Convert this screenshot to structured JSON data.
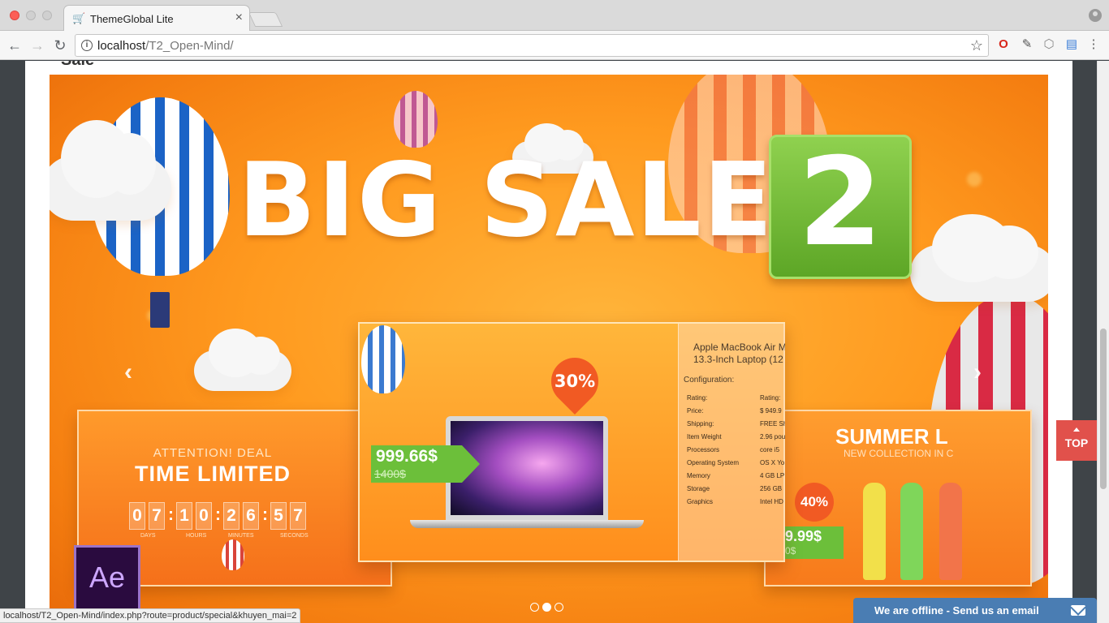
{
  "browser": {
    "tab_title": "ThemeGlobal Lite",
    "tab_favicon": "🛒",
    "tab_close": "×",
    "url_host": "localhost",
    "url_path": "/T2_Open-Mind/",
    "back": "←",
    "forward": "→",
    "reload": "↻",
    "star": "☆",
    "menu": "⋮",
    "status_url": "localhost/T2_Open-Mind/index.php?route=product/special&khuyen_mai=2"
  },
  "section": {
    "title": "Sale"
  },
  "banner": {
    "headline": "BIG SALE",
    "number": "2",
    "prev": "‹",
    "next": "›",
    "ae": "Ae",
    "dots_active_index": 1,
    "center": {
      "discount": "30%",
      "price": "999.66$",
      "old_price": "1400$",
      "product_title_1": "Apple MacBook Air M",
      "product_title_2": "13.3-Inch Laptop (12",
      "config_label": "Configuration:",
      "specs": [
        {
          "k": "Rating:",
          "v": "Rating:"
        },
        {
          "k": "Price:",
          "v": "$ 949.9"
        },
        {
          "k": "Shipping:",
          "v": "FREE Sh"
        },
        {
          "k": "Item Weight",
          "v": "2.96 pou"
        },
        {
          "k": "Processors",
          "v": "core i5"
        },
        {
          "k": "Operating System",
          "v": "OS X Yo"
        },
        {
          "k": "Memory",
          "v": "4 GB LP"
        },
        {
          "k": "Storage",
          "v": "256 GB"
        },
        {
          "k": "Graphics",
          "v": "Intel HD"
        }
      ]
    },
    "left": {
      "attention": "ATTENTION! DEAL",
      "time_limited": "TIME LIMITED",
      "digits": [
        "0",
        "7",
        "1",
        "0",
        "2",
        "6",
        "5",
        "7"
      ],
      "labels": [
        "DAYS",
        "HOURS",
        "MINUTES",
        "SECONDS"
      ]
    },
    "right": {
      "title": "SUMMER L",
      "subtitle": "NEW COLLECTION IN C",
      "discount": "40%",
      "price": "9.99$",
      "old_price": "0$"
    }
  },
  "top_button": {
    "label": "TOP"
  },
  "chat": {
    "label": "We are offline - Send us an email"
  },
  "colors": {
    "accent": "#e1514b",
    "chat": "#4a7db3",
    "banner": "#ff9a1f",
    "green": "#6cbf3a"
  }
}
